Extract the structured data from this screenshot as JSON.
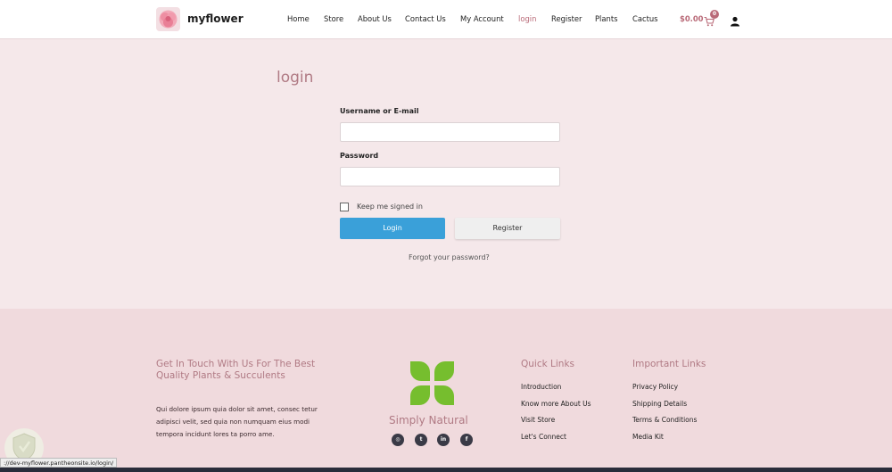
{
  "brand": {
    "name": "myflower"
  },
  "nav": {
    "items": [
      {
        "label": "Home",
        "active": false
      },
      {
        "label": "Store",
        "active": false
      },
      {
        "label": "About Us",
        "active": false
      },
      {
        "label": "Contact Us",
        "active": false
      },
      {
        "label": "My Account",
        "active": false
      },
      {
        "label": "login",
        "active": true
      },
      {
        "label": "Register",
        "active": false
      },
      {
        "label": "Plants",
        "active": false
      },
      {
        "label": "Cactus",
        "active": false
      }
    ],
    "cart_amount": "$0.00",
    "cart_count": "0"
  },
  "login": {
    "title": "login",
    "username_label": "Username or E-mail",
    "username_value": "",
    "password_label": "Password",
    "password_value": "",
    "remember_label": "Keep me signed in",
    "login_button": "Login",
    "register_button": "Register",
    "forgot_link": "Forgot your password?"
  },
  "footer": {
    "contact": {
      "title_line1": "Get In Touch With Us For The Best",
      "title_line2": "Quality Plants & Succulents",
      "text_line1": "Qui dolore ipsum quia dolor sit amet, consec tetur",
      "text_line2": "adipisci velit, sed quia non numquam eius modi",
      "text_line3": "tempora incidunt lores ta porro ame."
    },
    "brand_name": "Simply Natural",
    "social": [
      {
        "icon": "instagram-icon",
        "glyph": "◎"
      },
      {
        "icon": "twitter-icon",
        "glyph": "t"
      },
      {
        "icon": "linkedin-icon",
        "glyph": "in"
      },
      {
        "icon": "facebook-icon",
        "glyph": "f"
      }
    ],
    "quick_links": {
      "title": "Quick Links",
      "items": [
        "Introduction",
        "Know more About Us",
        "Visit Store",
        "Let's Connect"
      ]
    },
    "important_links": {
      "title": "Important Links",
      "items": [
        "Privacy Policy",
        "Shipping Details",
        "Terms & Conditions",
        "Media Kit"
      ]
    }
  },
  "status_bar": {
    "url": "://dev-myflower.pantheonsite.io/login/"
  },
  "colors": {
    "accent": "#b96a78",
    "login_button": "#3aa0d9",
    "leaf_green": "#76be2e"
  }
}
